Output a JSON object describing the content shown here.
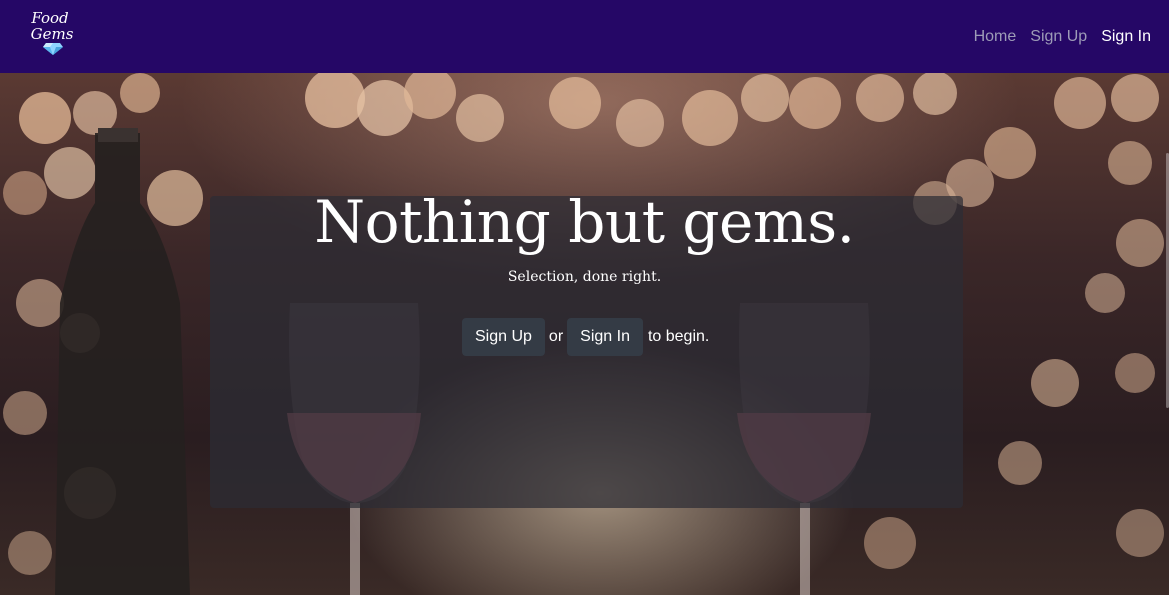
{
  "brand": {
    "line1": "Food",
    "line2": "Gems",
    "icon": "diamond-icon"
  },
  "nav": {
    "home": "Home",
    "sign_up": "Sign Up",
    "sign_in": "Sign In"
  },
  "hero": {
    "title": "Nothing but gems.",
    "subtitle": "Selection, done right.",
    "sign_up_button": "Sign Up",
    "or_text": "or",
    "sign_in_button": "Sign In",
    "tail_text": "to begin."
  },
  "colors": {
    "navbar": "#250766",
    "nav_inactive": "#9d9bb7",
    "nav_active": "#ffffff",
    "button_bg": "#343b45"
  }
}
